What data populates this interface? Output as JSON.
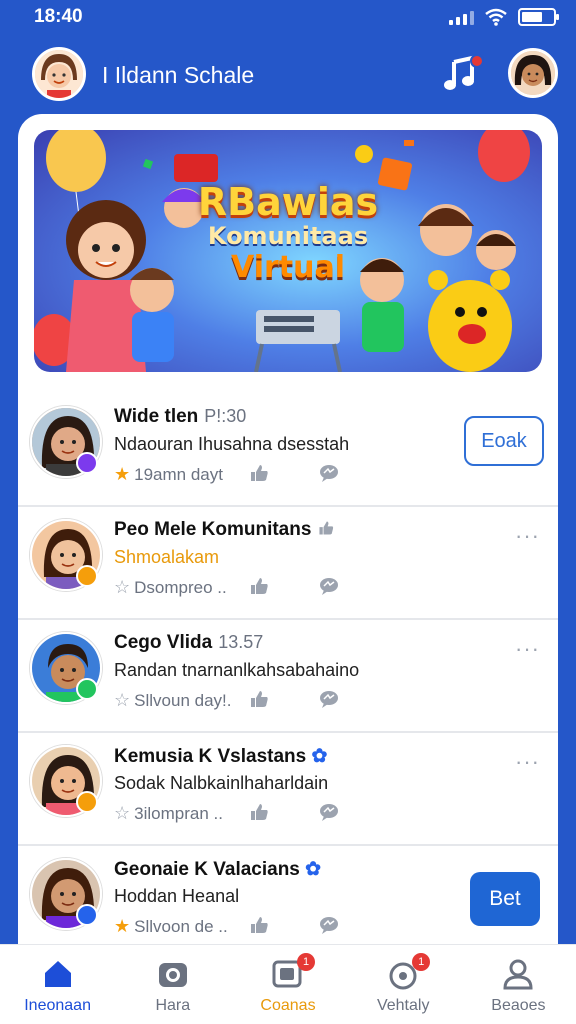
{
  "status": {
    "time": "18:40"
  },
  "header": {
    "title": "I Ildann Schale",
    "music_icon": "music-note-icon"
  },
  "banner": {
    "line1": "RBawias",
    "line2": "Komunitaas",
    "line3": "Virtual"
  },
  "rows": [
    {
      "name": "Wide tlen",
      "meta": "P!:30",
      "sub": "Ndaouran Ihusahna dsesstah",
      "foot": "19amn dayt",
      "action": "Eoak",
      "action_type": "outline",
      "badge_color": "#7c3aed",
      "avatar_bg": "#d9a27a"
    },
    {
      "name": "Peo Mele Komunitans",
      "meta": "",
      "sub": "Shmoalakam",
      "foot": "Dsompreo ..",
      "action": "···",
      "action_type": "more",
      "badge_color": "#f59e0b",
      "avatar_bg": "#f0b98c"
    },
    {
      "name": "Cego Vlida",
      "meta": "13.57",
      "sub": "Randan tnarnanlkahsabahaino",
      "foot": "Sllvoun day!.",
      "action": "···",
      "action_type": "more",
      "badge_color": "#22c55e",
      "avatar_bg": "#c98b5c"
    },
    {
      "name": "Kemusia K Vslastans",
      "meta": "",
      "sub": "Sodak Nalbkainlhaharldain",
      "foot": "3ilompran ..",
      "action": "···",
      "action_type": "more",
      "badge_color": "#f59e0b",
      "avatar_bg": "#e8b18a"
    },
    {
      "name": "Geonaie K Valacians",
      "meta": "",
      "sub": "Hoddan Heanal",
      "foot": "Sllvoon de ..",
      "action": "Bet",
      "action_type": "solid",
      "badge_color": "#2563eb",
      "avatar_bg": "#d29a72"
    }
  ],
  "nav": [
    {
      "label": "Ineonaan",
      "icon": "home-icon",
      "state": "active"
    },
    {
      "label": "Hara",
      "icon": "camera-icon",
      "state": "normal"
    },
    {
      "label": "Coanas",
      "icon": "gallery-icon",
      "state": "orange",
      "badge": "1"
    },
    {
      "label": "Vehtaly",
      "icon": "bell-ring-icon",
      "state": "normal",
      "badge": "1"
    },
    {
      "label": "Beaoes",
      "icon": "profile-icon",
      "state": "normal"
    }
  ],
  "colors": {
    "brand": "#2557c9",
    "accent": "#1f66d4",
    "orange": "#e89a0c"
  }
}
